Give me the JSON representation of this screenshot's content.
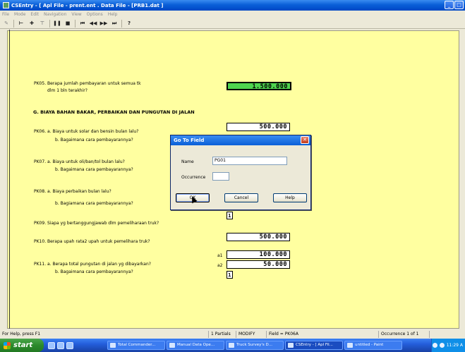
{
  "window": {
    "title": "CSEntry - [ Apl File - prent.ent . Data File - [PRB1.dat ]",
    "buttons": [
      "_",
      "□"
    ]
  },
  "menu": [
    "File",
    "Mode",
    "Edit",
    "Navigation",
    "View",
    "Options",
    "Help"
  ],
  "form": {
    "pk05": {
      "line1": "PK05. Berapa jumlah pembayaran untuk semua tk",
      "line2": "dlm 1 bln terakhir?",
      "value": "1.500.000"
    },
    "section_g": "G. BIAYA BAHAN BAKAR, PERBAIKAN DAN PUNGUTAN DI JALAN",
    "pk06": {
      "a": "PK06. a. Biaya untuk solar dan bensin bulan lalu?",
      "b": "b. Bagaimana cara pembayarannya?",
      "value": "500.000"
    },
    "pk07": {
      "a": "PK07. a. Biaya untuk oli/ban/tol bulan lalu?",
      "b": "b. Bagaimana cara pembayarannya?"
    },
    "pk08": {
      "a": "PK08. a. Biaya perbaikan bulan lalu?",
      "b": "b. Bagiamana cara pembayarannya?",
      "value_b": "1"
    },
    "pk09": {
      "text": "PK09. Siapa yg bertanggungjawab dlm pemeliharaan truk?"
    },
    "pk10": {
      "text": "PK10. Berapa upah rata2 upah untuk pemelihara truk?",
      "value": "500.000"
    },
    "pk11": {
      "a": "PK11. a. Berapa total pungutan di jalan yg dibayarkan?",
      "b": "b. Bagaimana cara pembayarannya?",
      "label_a1": "a1",
      "label_a2": "a2",
      "value_a1": "100.000",
      "value_a2": "50.000",
      "value_b": "1"
    }
  },
  "dialog": {
    "title": "Go To Field",
    "name_label": "Name",
    "name_value": "PG01",
    "occurrence_label": "Occurrence",
    "occurrence_value": "",
    "ok": "OK",
    "cancel": "Cancel",
    "help": "Help"
  },
  "status": {
    "help": "For Help, press F1",
    "partials": "1 Partials",
    "mode": "MODIFY",
    "field": "Field = PK06A",
    "occurrence": "Occurrence 1 of 1"
  },
  "taskbar": {
    "start": "start",
    "tasks": [
      "Total Commander...",
      "Manual Data Ope...",
      "Truck Survey's D...",
      "CSEntry - [ Apl Fil...",
      "untitled - Paint"
    ],
    "clock": "11:29 A"
  }
}
